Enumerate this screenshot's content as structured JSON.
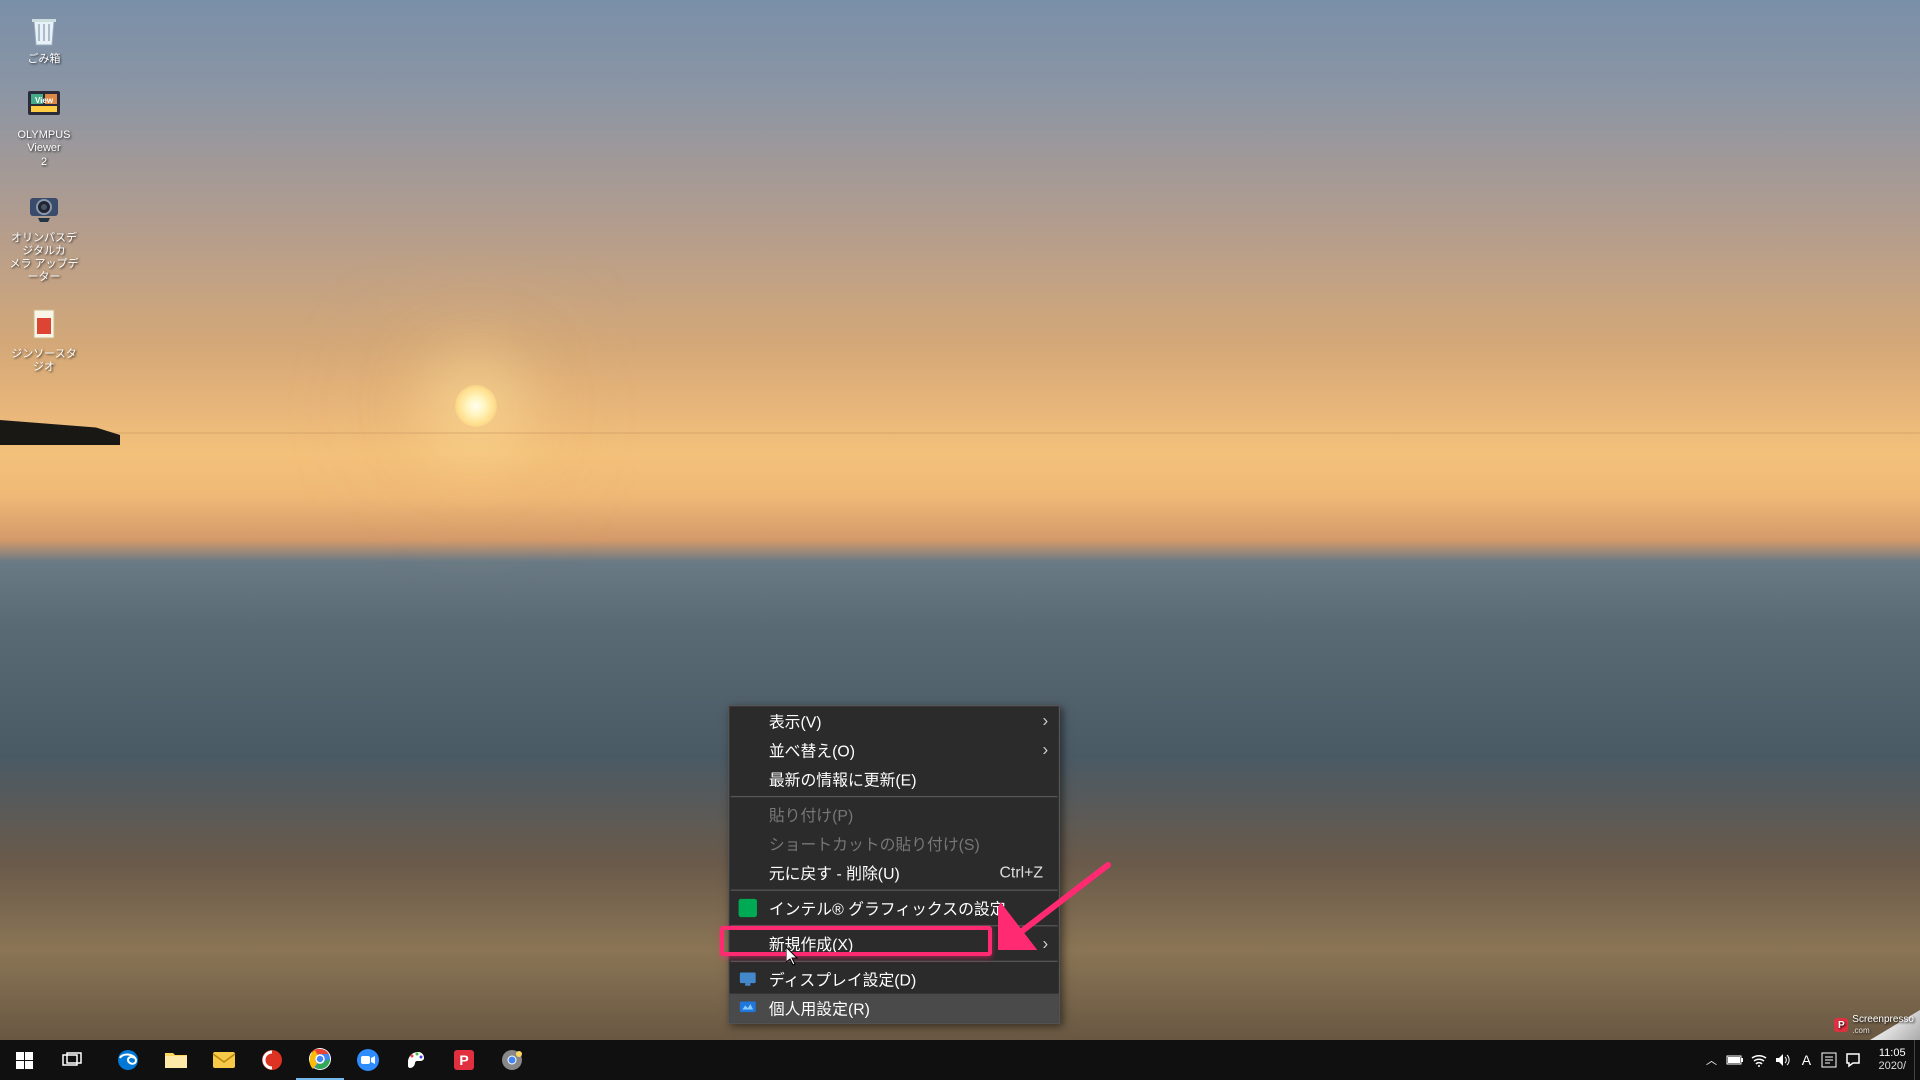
{
  "desktop_icons": [
    {
      "id": "recycle-bin",
      "label": "ごみ箱"
    },
    {
      "id": "olympus-viewer",
      "label": "OLYMPUS Viewer\n2"
    },
    {
      "id": "olympus-updater",
      "label": "オリンパスデジタルカ\nメラ アップデーター"
    },
    {
      "id": "jinsou-studio",
      "label": "ジンソースタジオ"
    }
  ],
  "context_menu": {
    "items": [
      {
        "label": "表示(V)",
        "sub": true
      },
      {
        "label": "並べ替え(O)",
        "sub": true
      },
      {
        "label": "最新の情報に更新(E)"
      },
      {
        "sep": true
      },
      {
        "label": "貼り付け(P)",
        "disabled": true
      },
      {
        "label": "ショートカットの貼り付け(S)",
        "disabled": true
      },
      {
        "label": "元に戻す - 削除(U)",
        "shortcut": "Ctrl+Z"
      },
      {
        "sep": true
      },
      {
        "label": "インテル® グラフィックスの設定",
        "icon": "intel"
      },
      {
        "sep": true
      },
      {
        "label": "新規作成(X)",
        "sub": true
      },
      {
        "sep": true
      },
      {
        "label": "ディスプレイ設定(D)",
        "icon": "display"
      },
      {
        "label": "個人用設定(R)",
        "icon": "personalize",
        "hover": true
      }
    ]
  },
  "taskbar": {
    "apps": [
      {
        "id": "start",
        "name": "start-button"
      },
      {
        "id": "taskview",
        "name": "task-view-button"
      },
      {
        "id": "edge",
        "name": "edge-browser"
      },
      {
        "id": "explorer",
        "name": "file-explorer"
      },
      {
        "id": "mail",
        "name": "mail-app"
      },
      {
        "id": "ccleaner",
        "name": "ccleaner-app"
      },
      {
        "id": "chrome",
        "name": "chrome-browser",
        "active": true
      },
      {
        "id": "zoom",
        "name": "zoom-app"
      },
      {
        "id": "paint",
        "name": "paint-app"
      },
      {
        "id": "p-app",
        "name": "p-app"
      },
      {
        "id": "chrome2",
        "name": "chrome-canary"
      }
    ],
    "tray": {
      "chevron": "︿",
      "ime_mode": "A",
      "time": "11:05",
      "date": "2020/"
    }
  },
  "watermark": {
    "text": "Screenpresso",
    "sub": ".com"
  }
}
